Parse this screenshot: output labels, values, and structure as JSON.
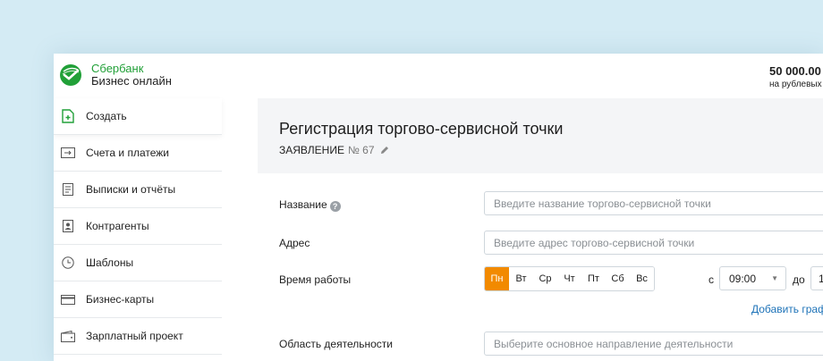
{
  "header": {
    "logo_top": "Сбербанк",
    "logo_bottom": "Бизнес онлайн",
    "balance_amount": "50 000.00",
    "balance_sub": "на рублевых"
  },
  "sidebar": {
    "items": [
      {
        "label": "Создать",
        "icon": "create-document-icon"
      },
      {
        "label": "Счета и платежи",
        "icon": "arrow-right-icon"
      },
      {
        "label": "Выписки и отчёты",
        "icon": "report-icon"
      },
      {
        "label": "Контрагенты",
        "icon": "contact-icon"
      },
      {
        "label": "Шаблоны",
        "icon": "clock-icon"
      },
      {
        "label": "Бизнес-карты",
        "icon": "card-icon"
      },
      {
        "label": "Зарплатный проект",
        "icon": "wallet-icon"
      }
    ]
  },
  "main": {
    "title": "Регистрация торгово-сервисной точки",
    "subtitle_label": "ЗАЯВЛЕНИЕ",
    "subtitle_number": "№ 67",
    "fields": {
      "name_label": "Название",
      "name_placeholder": "Введите название торгово-сервисной точки",
      "address_label": "Адрес",
      "address_placeholder": "Введите адрес торгово-сервисной точки",
      "hours_label": "Время работы",
      "days": [
        "Пн",
        "Вт",
        "Ср",
        "Чт",
        "Пт",
        "Сб",
        "Вс"
      ],
      "selected_day": "Пн",
      "from_label": "с",
      "from_value": "09:00",
      "to_label": "до",
      "to_value": "1",
      "add_schedule": "Добавить граф",
      "activity_label": "Область деятельности",
      "activity_placeholder": "Выберите основное направление деятельности"
    }
  },
  "colors": {
    "brand_green": "#21a038",
    "accent_orange": "#f28a00",
    "link_blue": "#1e73b8"
  }
}
